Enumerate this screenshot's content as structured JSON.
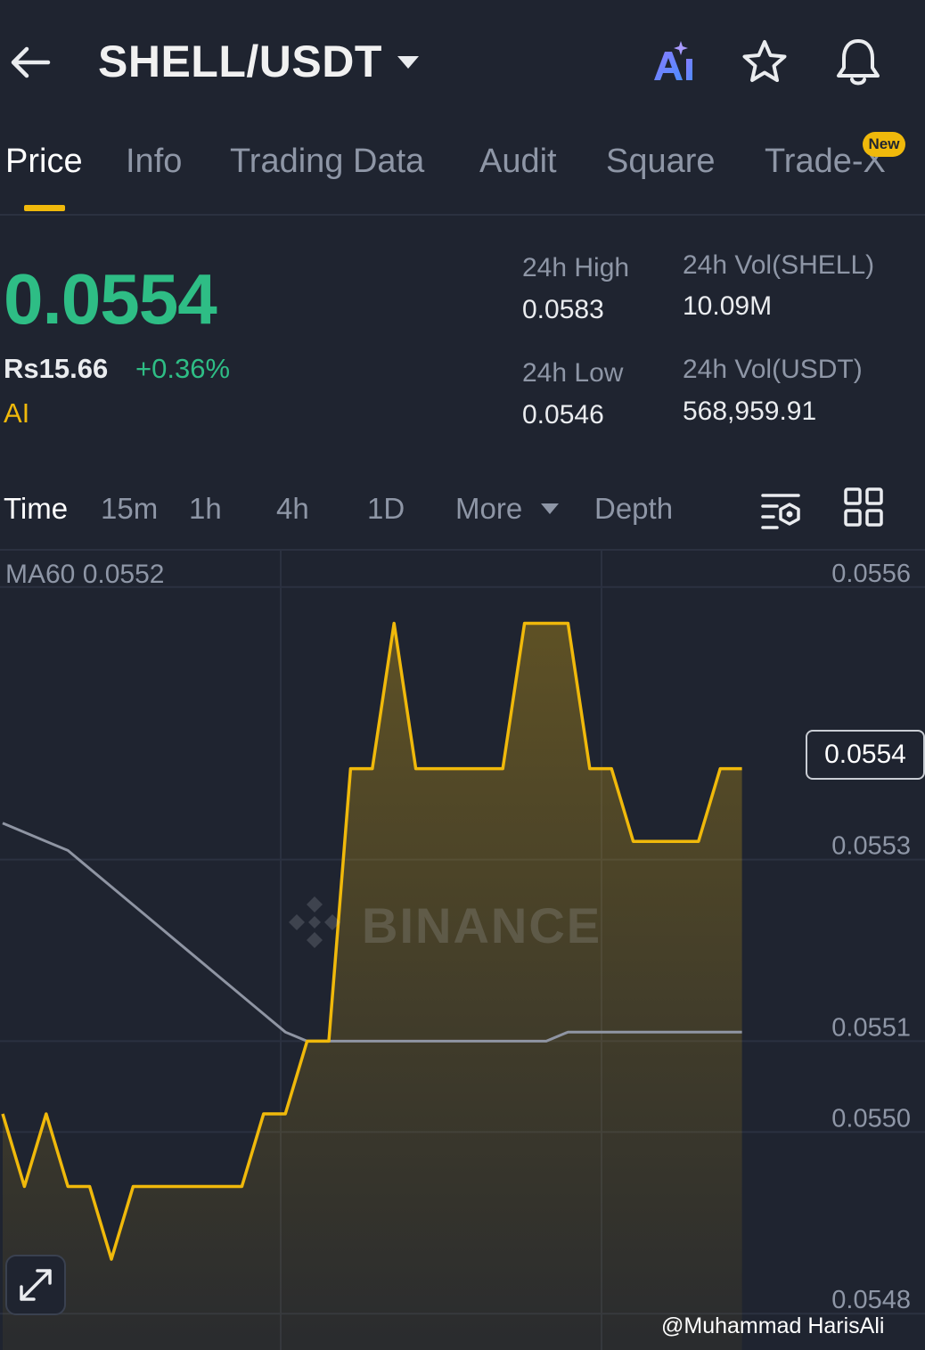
{
  "header": {
    "pair": "SHELL/USDT",
    "icons": [
      "back-arrow-icon",
      "caret-down-icon",
      "ai-icon",
      "star-icon",
      "bell-icon"
    ]
  },
  "tabs": [
    {
      "label": "Price",
      "active": true
    },
    {
      "label": "Info"
    },
    {
      "label": "Trading Data"
    },
    {
      "label": "Audit"
    },
    {
      "label": "Square"
    },
    {
      "label": "Trade-X",
      "badge": "New"
    }
  ],
  "ticker": {
    "last_price": "0.0554",
    "fiat_value": "Rs15.66",
    "change": "+0.36%",
    "ai_tag": "AI",
    "high_label": "24h High",
    "high_value": "0.0583",
    "low_label": "24h Low",
    "low_value": "0.0546",
    "vol_base_label": "24h Vol(SHELL)",
    "vol_base_value": "10.09M",
    "vol_quote_label": "24h Vol(USDT)",
    "vol_quote_value": "568,959.91"
  },
  "intervals": [
    "Time",
    "15m",
    "1h",
    "4h",
    "1D",
    "More",
    "Depth"
  ],
  "chart_data": {
    "type": "area",
    "indicator": "MA60 0.0552",
    "y_ticks": [
      "0.0556",
      "0.0553",
      "0.0551",
      "0.0550",
      "0.0548"
    ],
    "ylim": [
      0.05476,
      0.05564
    ],
    "current_price_label": "0.0554",
    "series": [
      {
        "values": [
          0.05502,
          0.05494,
          0.05502,
          0.05494,
          0.05494,
          0.05486,
          0.05494,
          0.05494,
          0.05494,
          0.05494,
          0.05494,
          0.05494,
          0.05502,
          0.05502,
          0.0551,
          0.0551,
          0.0554,
          0.0554,
          0.05556,
          0.0554,
          0.0554,
          0.0554,
          0.0554,
          0.0554,
          0.05556,
          0.05556,
          0.05556,
          0.0554,
          0.0554,
          0.05532,
          0.05532,
          0.05532,
          0.05532,
          0.0554,
          0.0554
        ]
      },
      {
        "values": [
          0.05534,
          0.05533,
          0.05532,
          0.05531,
          0.05529,
          0.05527,
          0.05525,
          0.05523,
          0.05521,
          0.05519,
          0.05517,
          0.05515,
          0.05513,
          0.05511,
          0.0551,
          0.0551,
          0.0551,
          0.0551,
          0.0551,
          0.0551,
          0.0551,
          0.0551,
          0.0551,
          0.0551,
          0.0551,
          0.0551,
          0.05511,
          0.05511,
          0.05511,
          0.05511,
          0.05511,
          0.05511,
          0.05511,
          0.05511,
          0.05511
        ]
      }
    ]
  },
  "watermark": "BINANCE",
  "credit": "@Muhammad HarisAli",
  "colors": {
    "background": "#1f2430",
    "up": "#2ebd85",
    "accent": "#f0b90b",
    "muted": "#8e96a6"
  }
}
